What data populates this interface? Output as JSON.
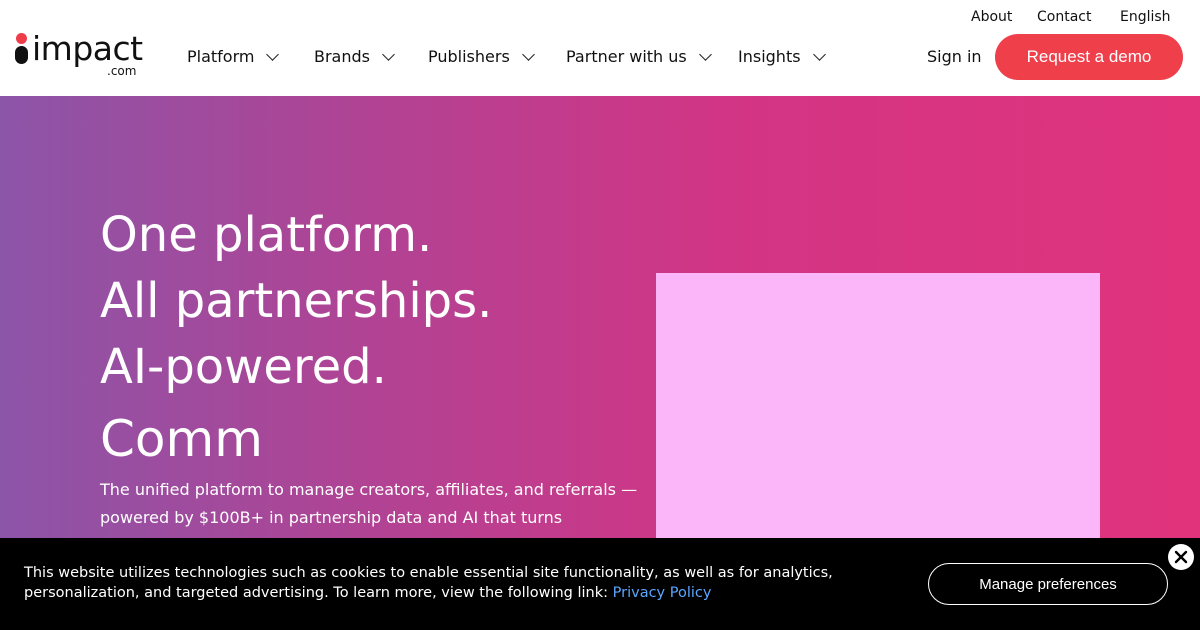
{
  "utility_nav": [
    "About",
    "Contact",
    "English"
  ],
  "logo": {
    "word": "impact",
    "tld": ".com"
  },
  "nav": [
    {
      "label": "Platform"
    },
    {
      "label": "Brands"
    },
    {
      "label": "Publishers"
    },
    {
      "label": "Partner with us"
    },
    {
      "label": "Insights"
    }
  ],
  "header": {
    "signin": "Sign in",
    "demo": "Request a demo"
  },
  "hero": {
    "headline": [
      "One platform.",
      "All partnerships.",
      "AI-powered."
    ],
    "rotating_word": "Comm",
    "subcopy": "The unified platform to manage creators, affiliates, and referrals — powered by $100B+ in partnership data and AI that turns discovery into performance."
  },
  "cookie": {
    "text": "This website utilizes technologies such as cookies to enable essential site functionality, as well as for analytics, personalization, and targeted advertising. To learn more, view the following link:",
    "link": "Privacy Policy",
    "manage": "Manage preferences"
  },
  "colors": {
    "accent": "#ef3f4b",
    "media_placeholder": "#fbb5f9",
    "link": "#5aa6ff"
  }
}
